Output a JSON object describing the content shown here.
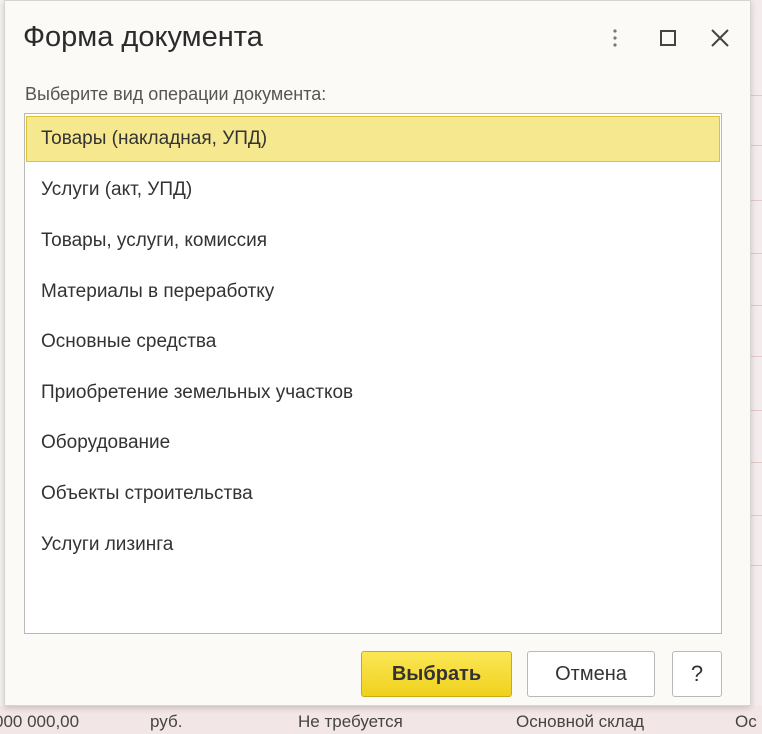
{
  "dialog": {
    "title": "Форма документа",
    "prompt": "Выберите вид операции документа:",
    "items": [
      {
        "label": "Товары (накладная, УПД)",
        "selected": true
      },
      {
        "label": "Услуги (акт, УПД)",
        "selected": false
      },
      {
        "label": "Товары, услуги, комиссия",
        "selected": false
      },
      {
        "label": "Материалы в переработку",
        "selected": false
      },
      {
        "label": "Основные средства",
        "selected": false
      },
      {
        "label": "Приобретение земельных участков",
        "selected": false
      },
      {
        "label": "Оборудование",
        "selected": false
      },
      {
        "label": "Объекты строительства",
        "selected": false
      },
      {
        "label": "Услуги лизинга",
        "selected": false
      }
    ],
    "buttons": {
      "select": "Выбрать",
      "cancel": "Отмена",
      "help": "?"
    }
  },
  "background_row": {
    "amount": "000 000,00",
    "currency": "руб.",
    "status": "Не требуется",
    "warehouse": "Основной склад",
    "extra": "Ос"
  },
  "colors": {
    "selection": "#f6e88e",
    "primary_button": "#efd11c"
  }
}
